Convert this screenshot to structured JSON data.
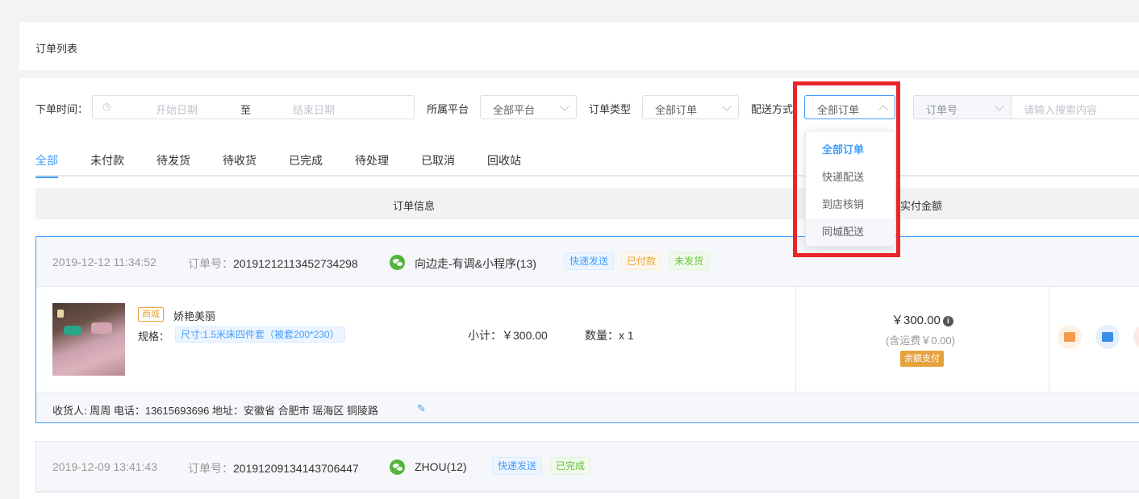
{
  "header": {
    "title": "订单列表"
  },
  "filters": {
    "order_time_label": "下单时间：",
    "start_placeholder": "开始日期",
    "to_label": "至",
    "end_placeholder": "结束日期",
    "platform_label": "所属平台",
    "platform_value": "全部平台",
    "type_label": "订单类型",
    "type_value": "全部订单",
    "delivery_label": "配送方式",
    "delivery_value": "全部订单",
    "search_field": "订单号",
    "search_placeholder": "请输入搜索内容"
  },
  "delivery_options": [
    "全部订单",
    "快递配送",
    "到店核销",
    "同城配送"
  ],
  "tabs": [
    "全部",
    "未付款",
    "待发货",
    "待收货",
    "已完成",
    "待处理",
    "已取消",
    "回收站"
  ],
  "table_head": {
    "order_info": "订单信息",
    "paid_amount": "实付金额"
  },
  "orders": [
    {
      "time": "2019-12-12 11:34:52",
      "order_no_label": "订单号：",
      "order_no": "20191212113452734298",
      "user": "向边走-有调&小程序(13)",
      "tags": [
        "快递发送",
        "已付款",
        "未发货"
      ],
      "mall_tag": "商城",
      "product_name": "娇艳美丽",
      "spec_label": "规格：",
      "spec": "尺寸:1.5米床四件套（被套200*230）",
      "subtotal": "小计：￥300.00",
      "qty": "数量：x 1",
      "price": "￥300.00",
      "shipping": "(含运费￥0.00)",
      "pay_method": "余额支付",
      "address": "收货人: 周周 电话：13615693696 地址：安徽省 合肥市 瑶海区 铜陵路"
    },
    {
      "time": "2019-12-09 13:41:43",
      "order_no_label": "订单号：",
      "order_no": "20191209134143706447",
      "user": "ZHOU(12)",
      "tags": [
        "快递发送",
        "已完成"
      ]
    }
  ],
  "colors": {
    "accent": "#409eff",
    "highlight": "#e8262b"
  }
}
